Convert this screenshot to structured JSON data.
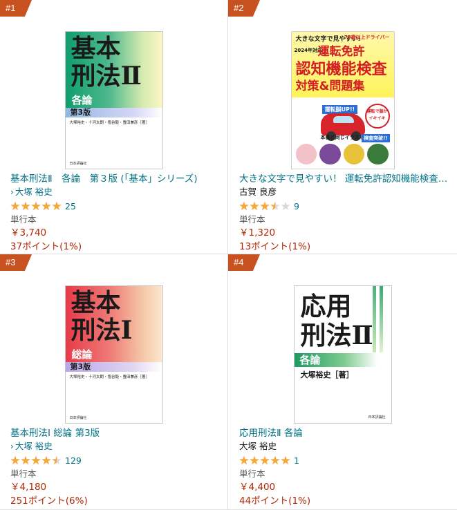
{
  "colors": {
    "badge": "#c7511f",
    "link": "#007185",
    "price": "#b12704",
    "star": "#f7a535"
  },
  "items": [
    {
      "rank": "#1",
      "title": "基本刑法Ⅱ　各論　第３版 (「基本」シリーズ)",
      "author": "大塚 裕史",
      "author_is_link": true,
      "rating": 5.0,
      "review_count": "25",
      "format": "単行本",
      "price": "￥3,740",
      "points": "37ポイント(1%)",
      "cover": {
        "big_line1": "基本",
        "big_line2": "刑法Ⅱ",
        "sub": "各論",
        "edition": "第3版",
        "authors": "大塚裕史・十河太朗・塩谷毅・豊田兼彦［著］",
        "publisher": "日本評論社"
      }
    },
    {
      "rank": "#2",
      "title": "大きな文字で見やすい！ 運転免許認知機能検査対策&問題集",
      "author": "古賀 良彦",
      "author_is_link": false,
      "rating": 3.5,
      "review_count": "9",
      "format": "単行本",
      "price": "￥1,320",
      "points": "13ポイント(1%)",
      "cover": {
        "line1": "大きな文字で見やすい!",
        "year": "2024年対応",
        "line2": "運転免許",
        "line3": "認知機能検査",
        "line4": "対策&問題集",
        "badge_up": "運転脳UP!!",
        "circle": "運転で脳がイキイキ",
        "same": "本番と同じイラストで",
        "kensa": "検査突破!!",
        "corner": "75歳以上ドライバー"
      }
    },
    {
      "rank": "#3",
      "title": "基本刑法I 総論 第3版",
      "author": "大塚 裕史",
      "author_is_link": true,
      "rating": 4.5,
      "review_count": "129",
      "format": "単行本",
      "price": "￥4,180",
      "points": "251ポイント(6%)",
      "cover": {
        "big_line1": "基本",
        "big_line2": "刑法Ⅰ",
        "sub": "総論",
        "edition": "第3版",
        "authors": "大塚裕史・十河太朗・塩谷毅・豊田兼彦［著］",
        "publisher": "日本評論社"
      }
    },
    {
      "rank": "#4",
      "title": "応用刑法Ⅱ 各論",
      "author": "大塚 裕史",
      "author_is_link": false,
      "rating": 5.0,
      "review_count": "1",
      "format": "単行本",
      "price": "￥4,400",
      "points": "44ポイント(1%)",
      "cover": {
        "big_line1": "応用",
        "big_line2": "刑法Ⅱ",
        "sub": "各論",
        "author": "大塚裕史［著］",
        "publisher": "日本評論社"
      }
    }
  ]
}
